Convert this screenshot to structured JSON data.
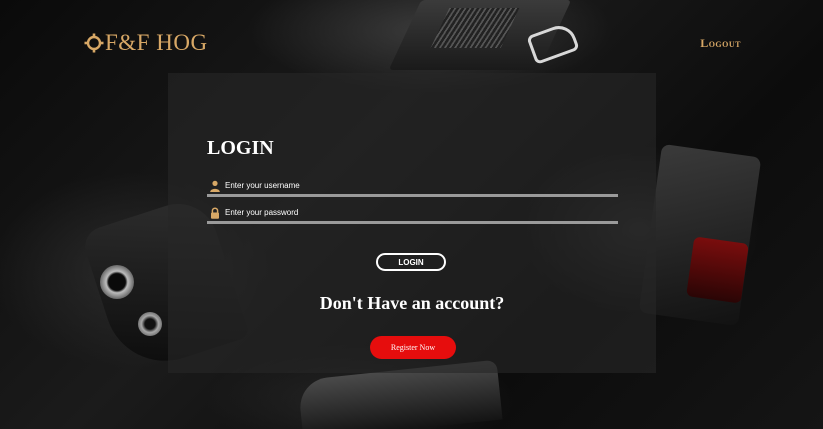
{
  "header": {
    "brand_text": "F&F HOG",
    "logout_label": "Logout"
  },
  "login": {
    "title": "LOGIN",
    "username_placeholder": "Enter your username",
    "password_placeholder": "Enter your password",
    "button_label": "LOGIN",
    "no_account_text": "Don't Have an account?",
    "register_label": "Register Now"
  },
  "colors": {
    "brand_accent": "#d8a866",
    "register_button": "#e60d0d",
    "field_icon": "#d8a866"
  },
  "icons": {
    "brand": "crosshair-icon",
    "username": "user-icon",
    "password": "lock-icon"
  }
}
